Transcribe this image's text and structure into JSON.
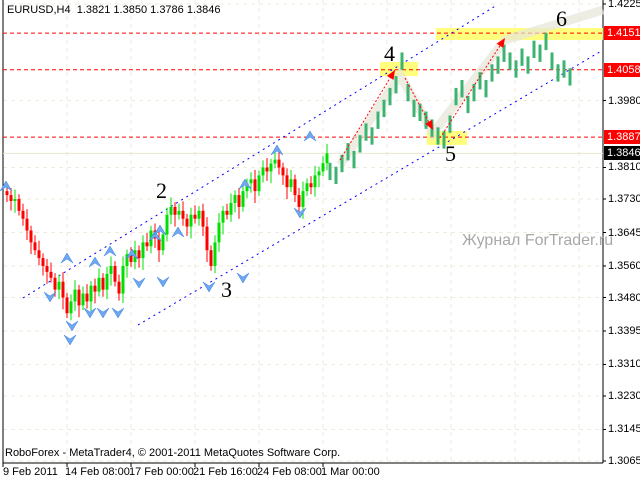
{
  "header": {
    "symbol": "EURUSD,H4",
    "open": "1.3821",
    "high": "1.3850",
    "low": "1.3786",
    "close": "1.3846"
  },
  "footer": {
    "copyright": "RoboForex - MetaTrader4, © 2001-2011 MetaQuotes Software Corp."
  },
  "watermark": "Журнал ForTrader.ru",
  "chart_data": {
    "type": "candlestick",
    "symbol": "EURUSD",
    "timeframe": "H4",
    "ylim": [
      1.3065,
      1.4225
    ],
    "y_ticks": [
      "1.4225",
      "1.3980",
      "1.3810",
      "1.3730",
      "1.3645",
      "1.3560",
      "1.3480",
      "1.3395",
      "1.3310",
      "1.3230",
      "1.3145",
      "1.3065"
    ],
    "y_tick_values": [
      1.4225,
      1.398,
      1.381,
      1.373,
      1.3645,
      1.356,
      1.348,
      1.3395,
      1.331,
      1.323,
      1.3145,
      1.3065
    ],
    "x_ticks": [
      "9 Feb 2011",
      "14 Feb 08:00",
      "17 Feb 00:00",
      "21 Feb 16:00",
      "24 Feb 08:00",
      "1 Mar 00:00"
    ],
    "x_tick_bars": [
      0,
      16,
      32,
      48,
      64,
      80
    ],
    "closes": [
      1.374,
      1.3725,
      1.373,
      1.37,
      1.368,
      1.365,
      1.362,
      1.36,
      1.358,
      1.356,
      1.3545,
      1.353,
      1.35,
      1.352,
      1.348,
      1.344,
      1.347,
      1.35,
      1.346,
      1.349,
      1.347,
      1.351,
      1.3495,
      1.353,
      1.35,
      1.354,
      1.356,
      1.352,
      1.349,
      1.356,
      1.359,
      1.357,
      1.36,
      1.358,
      1.362,
      1.361,
      1.365,
      1.363,
      1.36,
      1.364,
      1.369,
      1.371,
      1.369,
      1.37,
      1.368,
      1.366,
      1.369,
      1.368,
      1.37,
      1.366,
      1.36,
      1.356,
      1.362,
      1.367,
      1.37,
      1.369,
      1.372,
      1.374,
      1.371,
      1.375,
      1.377,
      1.378,
      1.375,
      1.379,
      1.381,
      1.38,
      1.382,
      1.383,
      1.381,
      1.379,
      1.376,
      1.378,
      1.374,
      1.371,
      1.375,
      1.377,
      1.376,
      1.379,
      1.38,
      1.3821,
      1.3846
    ],
    "forecast_centers": [
      1.38,
      1.379,
      1.382,
      1.385,
      1.383,
      1.387,
      1.39,
      1.389,
      1.393,
      1.396,
      1.399,
      1.402,
      1.408,
      1.4,
      1.396,
      1.395,
      1.393,
      1.391,
      1.389,
      1.388,
      1.392,
      1.399,
      1.401,
      1.397,
      1.4,
      1.403,
      1.401,
      1.405,
      1.407,
      1.41,
      1.408,
      1.406,
      1.409,
      1.407,
      1.411,
      1.41,
      1.413,
      1.408,
      1.405,
      1.406,
      1.404
    ],
    "levels": [
      {
        "price": "1.4151",
        "color": "#ff0000"
      },
      {
        "price": "1.4058",
        "color": "#ff0000"
      },
      {
        "price": "1.3887",
        "color": "#ff0000"
      }
    ],
    "current_price": "1.3846",
    "wave_labels": [
      "2",
      "3",
      "4",
      "5",
      "6"
    ],
    "colors": {
      "bull": "#00e000",
      "bear": "#ff0000",
      "forecast": "#3cb371",
      "channel": "#0000ff",
      "highlight": "#ffff66"
    }
  }
}
